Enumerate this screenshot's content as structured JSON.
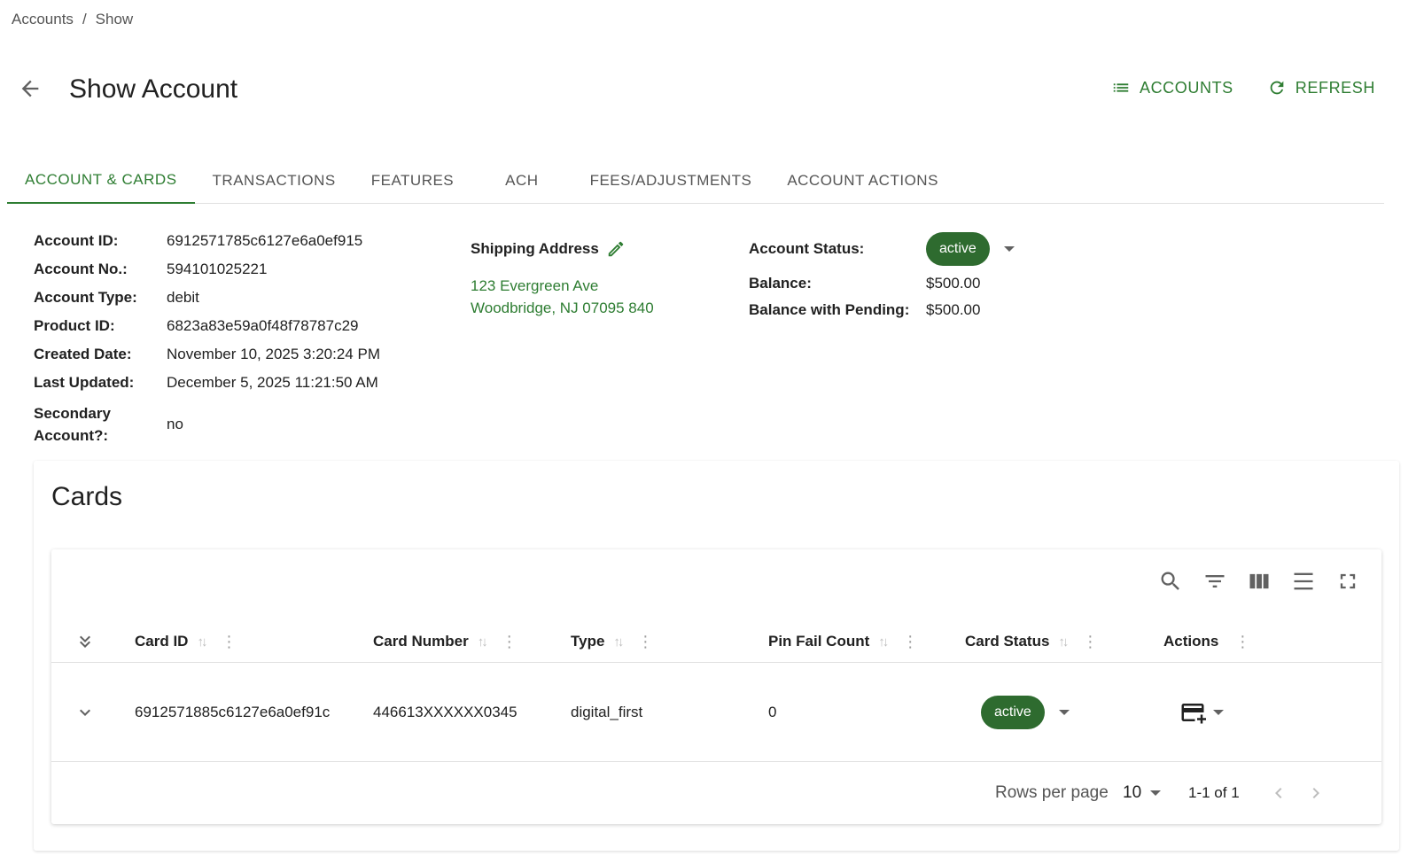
{
  "breadcrumb": {
    "items": [
      "Accounts",
      "Show"
    ],
    "separator": "/"
  },
  "page": {
    "title": "Show Account"
  },
  "header_actions": {
    "accounts_label": "ACCOUNTS",
    "refresh_label": "REFRESH"
  },
  "tabs": [
    {
      "label": "ACCOUNT & CARDS",
      "active": true
    },
    {
      "label": "TRANSACTIONS",
      "active": false
    },
    {
      "label": "FEATURES",
      "active": false
    },
    {
      "label": "ACH",
      "active": false
    },
    {
      "label": "FEES/ADJUSTMENTS",
      "active": false
    },
    {
      "label": "ACCOUNT ACTIONS",
      "active": false
    }
  ],
  "account": {
    "id_label": "Account ID:",
    "id": "6912571785c6127e6a0ef915",
    "no_label": "Account No.:",
    "no": "594101025221",
    "type_label": "Account Type:",
    "type": "debit",
    "product_label": "Product ID:",
    "product": "6823a83e59a0f48f78787c29",
    "created_label": "Created Date:",
    "created": "November 10, 2025 3:20:24 PM",
    "updated_label": "Last Updated:",
    "updated": "December 5, 2025 11:21:50 AM",
    "secondary_label": "Secondary Account?:",
    "secondary": "no"
  },
  "shipping": {
    "title": "Shipping Address",
    "line1": "123 Evergreen Ave",
    "line2": "Woodbridge, NJ 07095 840"
  },
  "status": {
    "status_label": "Account Status:",
    "status": "active",
    "balance_label": "Balance:",
    "balance": "$500.00",
    "pending_label": "Balance with Pending:",
    "pending": "$500.00"
  },
  "cards": {
    "title": "Cards",
    "columns": [
      "Card ID",
      "Card Number",
      "Type",
      "Pin Fail Count",
      "Card Status",
      "Actions"
    ],
    "rows": [
      {
        "card_id": "6912571885c6127e6a0ef91c",
        "card_number": "446613XXXXXX0345",
        "type": "digital_first",
        "pin_fail": "0",
        "status": "active"
      }
    ],
    "pagination": {
      "rows_label": "Rows per page",
      "rows_value": "10",
      "range": "1-1 of 1"
    }
  },
  "colors": {
    "accent": "#2e7d32",
    "chip": "#2e6b2f"
  }
}
